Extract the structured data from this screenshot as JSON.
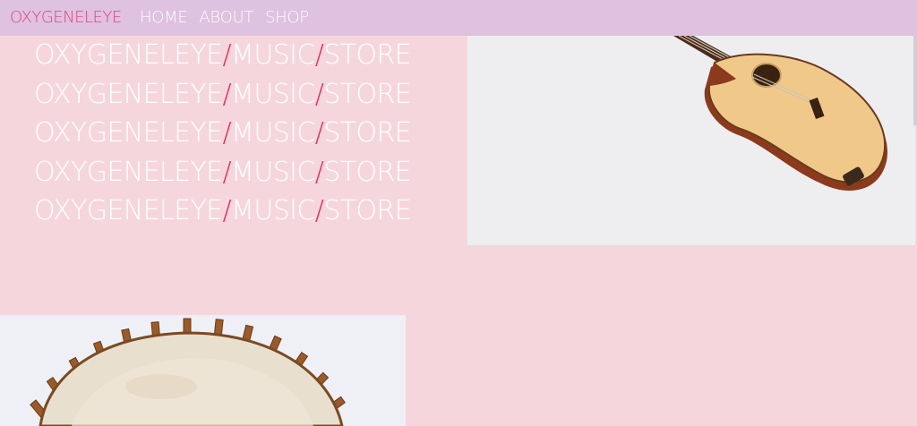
{
  "nav": {
    "brand": "OXYGENELEYE",
    "links": [
      "HOME",
      "ABOUT",
      "SHOP"
    ]
  },
  "hero": {
    "lines": [
      {
        "a": "OXYGENELEYE",
        "sep1": "/",
        "b": "MUSIC",
        "sep2": "/",
        "c": "STORE"
      },
      {
        "a": "OXYGENELEYE",
        "sep1": "/",
        "b": "MUSIC",
        "sep2": "/",
        "c": "STORE"
      },
      {
        "a": "OXYGENELEYE",
        "sep1": "/",
        "b": "MUSIC",
        "sep2": "/",
        "c": "STORE"
      },
      {
        "a": "OXYGENELEYE",
        "sep1": "/",
        "b": "MUSIC",
        "sep2": "/",
        "c": "STORE"
      },
      {
        "a": "OXYGENELEYE",
        "sep1": "/",
        "b": "MUSIC",
        "sep2": "/",
        "c": "STORE"
      }
    ]
  },
  "images": {
    "guitar_icon": "acoustic-bass-guitar-image",
    "drum_icon": "djembe-drum-image"
  },
  "colors": {
    "page_bg": "#f6d6dd",
    "nav_bg": "#dfc1e0",
    "brand": "#e0457b",
    "slash": "#e0335a"
  }
}
